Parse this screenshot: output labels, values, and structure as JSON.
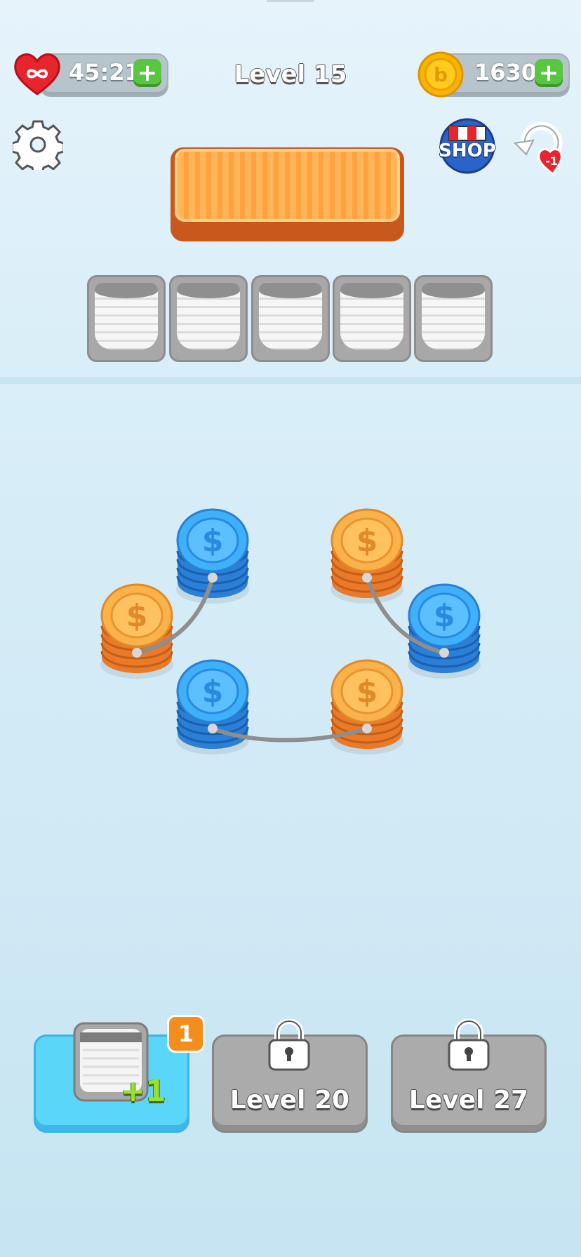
{
  "top_bar": {
    "lives_timer": "45:21",
    "level_title": "Level 15",
    "coins": "1630",
    "plus_symbol": "+",
    "shop_label": "SHOP",
    "undo_badge": "-1"
  },
  "slots": {
    "count": 5
  },
  "coin_stacks": [
    {
      "color": "blue",
      "symbol": "$"
    },
    {
      "color": "orange",
      "symbol": "$"
    },
    {
      "color": "orange",
      "symbol": "$"
    },
    {
      "color": "blue",
      "symbol": "$"
    },
    {
      "color": "blue",
      "symbol": "$"
    },
    {
      "color": "orange",
      "symbol": "$"
    }
  ],
  "powerups": {
    "add_slot_badge": "1",
    "add_slot_label": "+1",
    "locked_1_label": "Level 20",
    "locked_2_label": "Level 27"
  },
  "colors": {
    "blue_coin": "#3aa0f0",
    "orange_coin": "#f7a23a",
    "tray": "#ffa23e",
    "button_blue": "#5ad6f9",
    "button_gray": "#ababab"
  }
}
